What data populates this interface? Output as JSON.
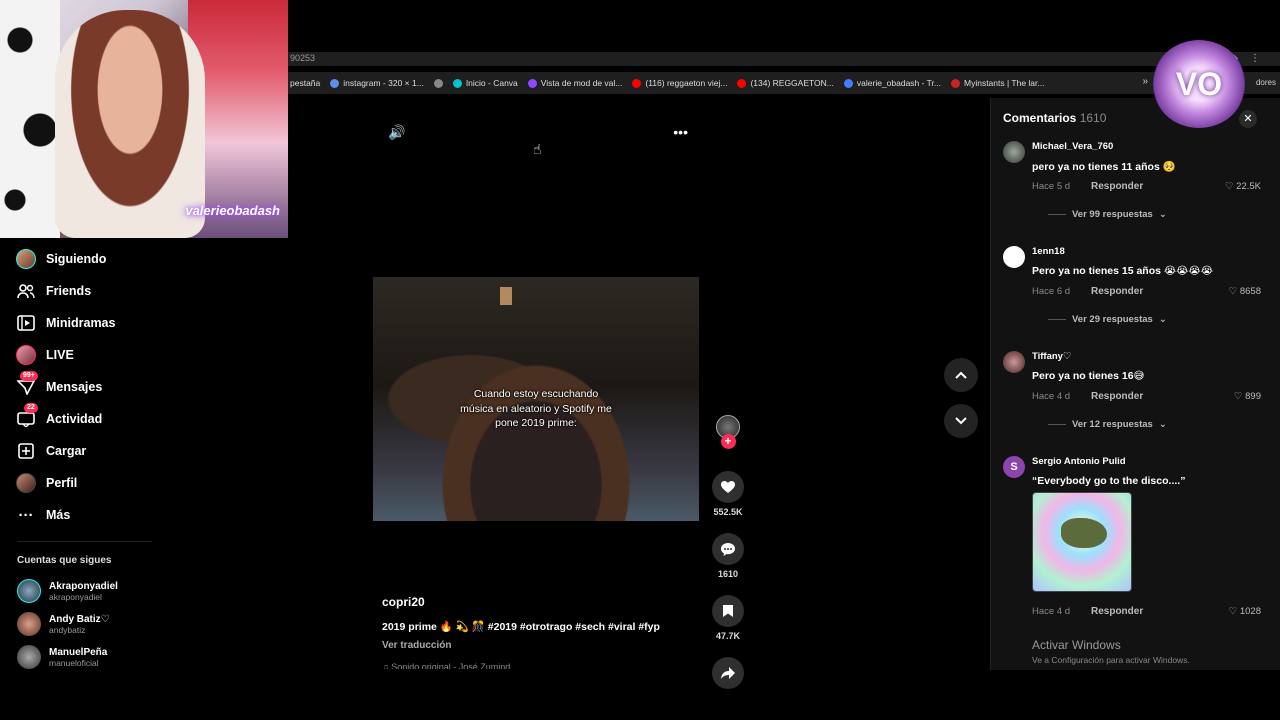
{
  "browser": {
    "address_fragment": "90253",
    "bookmarks": [
      {
        "label": "pestaña",
        "color": "#1f1f1f"
      },
      {
        "label": "instagram - 320 × 1...",
        "color": "#5b8def"
      },
      {
        "label": "",
        "color": "#888888"
      },
      {
        "label": "Inicio - Canva",
        "color": "#00c4cc"
      },
      {
        "label": "Vista de mod de val...",
        "color": "#9146ff"
      },
      {
        "label": "(116) reggaeton viej...",
        "color": "#ff0000"
      },
      {
        "label": "(134) REGGAETON...",
        "color": "#ff0000"
      },
      {
        "label": "valerie_obadash - Tr...",
        "color": "#3f7fff"
      },
      {
        "label": "Myinstants | The lar...",
        "color": "#cc2222"
      }
    ],
    "bookmarks_overflow": "»",
    "bookmarks_tail": "dores"
  },
  "webcam": {
    "overlay_text": "valerieobadash"
  },
  "sidebar": {
    "items": [
      {
        "label": "Siguiendo",
        "icon": "following-avatar-icon"
      },
      {
        "label": "Friends",
        "icon": "friends-icon"
      },
      {
        "label": "Minidramas",
        "icon": "film-icon"
      },
      {
        "label": "LIVE",
        "icon": "live-avatar-icon"
      },
      {
        "label": "Mensajes",
        "icon": "messages-icon",
        "badge": "99+"
      },
      {
        "label": "Actividad",
        "icon": "activity-icon",
        "badge": "22"
      },
      {
        "label": "Cargar",
        "icon": "upload-icon"
      },
      {
        "label": "Perfil",
        "icon": "profile-avatar-icon"
      },
      {
        "label": "Más",
        "icon": "more-icon"
      }
    ],
    "following_title": "Cuentas que sigues",
    "following": [
      {
        "name": "Akraponyadiel",
        "handle": "akraponyadiel"
      },
      {
        "name": "Andy Batiz♡",
        "handle": "andybatiz"
      },
      {
        "name": "ManuelPeña",
        "handle": "manueloficial"
      }
    ]
  },
  "video": {
    "caption": "Cuando estoy escuchando música en aleatorio y Spotify me pone 2019 prime:",
    "author": "copri20",
    "description": "2019 prime 🔥 💫 🎊 #2019 #otrotrago #sech #viral #fyp",
    "translate": "Ver traducción",
    "sound": "♫ Sonido original - José Zumind",
    "likes": "552.5K",
    "comments": "1610",
    "saves": "47.7K",
    "accent": "#fe2c55"
  },
  "comments_panel": {
    "title": "Comentarios",
    "count": "1610",
    "reply_label": "Responder",
    "items": [
      {
        "user": "Michael_Vera_760",
        "text": "pero ya no tienes 11 años 🥺",
        "date": "Hace 5 d",
        "likes": "22.5K",
        "more": "Ver 99 respuestas"
      },
      {
        "user": "1enn18",
        "text": "Pero ya no tienes 15 años 😭😭😭😭",
        "date": "Hace 6 d",
        "likes": "8658",
        "more": "Ver 29 respuestas"
      },
      {
        "user": "Tiffany♡",
        "text": "Pero ya no tienes 16😅",
        "date": "Hace 4 d",
        "likes": "899",
        "more": "Ver 12 respuestas"
      },
      {
        "user": "Sergio Antonio Pulid",
        "text": "“Everybody go to the disco....”",
        "date": "Hace 4 d",
        "likes": "1028",
        "avatar_letter": "S"
      }
    ]
  },
  "os_watermark": {
    "title": "Activar Windows",
    "subtitle": "Ve a Configuración para activar Windows."
  },
  "brand_logo_text": "VO"
}
